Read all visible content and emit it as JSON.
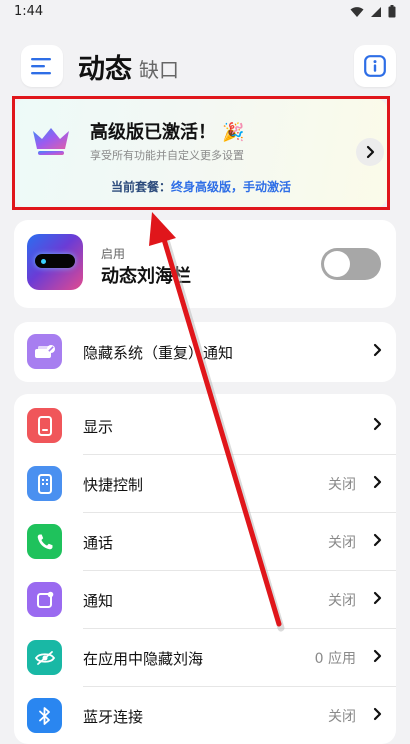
{
  "status_bar": {
    "time": "1:44"
  },
  "header": {
    "title": "动态",
    "subtitle": "缺口"
  },
  "premium": {
    "title": "高级版已激活！",
    "party_emoji": "🎉",
    "subtitle": "享受所有功能并自定义更多设置",
    "plan_label": "当前套餐：",
    "plan_value": "终身高级版，手动激活"
  },
  "notch": {
    "status_label": "启用",
    "title": "动态刘海栏",
    "toggle_on": false
  },
  "hidden_notifications": {
    "label": "隐藏系统（重复）通知"
  },
  "settings": [
    {
      "label": "显示",
      "value": ""
    },
    {
      "label": "快捷控制",
      "value": "关闭"
    },
    {
      "label": "通话",
      "value": "关闭"
    },
    {
      "label": "通知",
      "value": "关闭"
    },
    {
      "label": "在应用中隐藏刘海",
      "value": "0 应用"
    },
    {
      "label": "蓝牙连接",
      "value": "关闭"
    }
  ],
  "colors": {
    "annotation_red": "#e0161b",
    "accent_blue": "#2e6ee6",
    "display_icon": "#f0565a",
    "quick_control_icon": "#4a90f0",
    "call_icon": "#1fc25c",
    "notification_icon": "#9a6af0",
    "hide_notch_icon": "#19b8a5",
    "bluetooth_icon": "#2a86f0"
  },
  "icons": {
    "menu": "menu-icon",
    "info": "info-icon",
    "crown": "crown-icon",
    "display": "display-icon",
    "quick_control": "quick-control-icon",
    "call": "phone-icon",
    "notification": "notification-icon",
    "hide_notch": "eye-off-icon",
    "bluetooth": "bluetooth-icon"
  }
}
